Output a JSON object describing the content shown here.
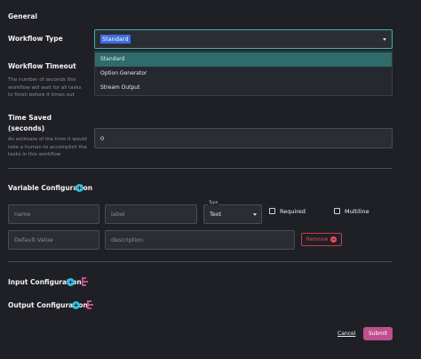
{
  "general": {
    "section_title": "General",
    "workflow_type": {
      "label": "Workflow Type",
      "selected": "Standard",
      "options": [
        "Standard",
        "Option Generator",
        "Stream Output"
      ]
    },
    "workflow_timeout": {
      "label": "Workflow Timeout",
      "help": "The number of seconds this workflow will wait for all tasks to finish before it times out"
    },
    "time_saved": {
      "label_line1": "Time Saved",
      "label_line2": "(seconds)",
      "help": "An estimate of the time it would take a human to accomplish the tasks in this workflow",
      "value": "0"
    }
  },
  "variable_config": {
    "title": "Variable Configuration",
    "name_placeholder": "name",
    "label_placeholder": "label",
    "type_tag": "Type",
    "type_value": "Text",
    "required_label": "Required",
    "multiline_label": "Multiline",
    "default_placeholder": "Default Value",
    "description_placeholder": "description",
    "remove_label": "Remove"
  },
  "input_config": {
    "title": "Input Configuration"
  },
  "output_config": {
    "title": "Output Configuration"
  },
  "footer": {
    "cancel_label": "Cancel",
    "submit_label": "Submit"
  },
  "colors": {
    "background": "#1f2026",
    "accent_teal": "#36b7b0",
    "add_icon": "#35bfe0",
    "branch_icon": "#c0508d",
    "remove": "#e34b57",
    "submit": "#c0508d"
  },
  "icons": [
    "chevron-down-icon",
    "plus-circle-icon",
    "branch-icon",
    "remove-circle-icon"
  ]
}
